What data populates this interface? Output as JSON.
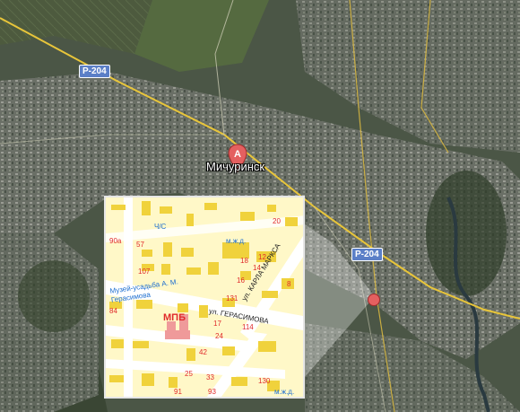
{
  "map": {
    "city_name": "Мичуринск",
    "marker_letter": "A",
    "road_labels": [
      "Р-204",
      "Р-204"
    ]
  },
  "inset": {
    "hospital_label": "МПБ",
    "street_labels": [
      "ул. ГЕРАСИМОВА",
      "ул. КАРЛА МАРКСА"
    ],
    "museum_label": "Музей-усадьба А. М. Герасимова",
    "rail_labels": [
      "м.ж.д.",
      "м.ж.д."
    ],
    "school_label": "Ч/С",
    "house_numbers": [
      "90а",
      "57",
      "107",
      "84",
      "20",
      "18",
      "16",
      "14",
      "12",
      "131",
      "17",
      "24",
      "114",
      "42",
      "130",
      "91",
      "93",
      "25",
      "33",
      "8"
    ]
  },
  "colors": {
    "inset_background": "#fff8c8",
    "building": "#f0d23c",
    "street": "#ffffff",
    "marker": "#e46060",
    "road_shield": "#5b7fc7",
    "hospital": "#ef9a9a"
  }
}
